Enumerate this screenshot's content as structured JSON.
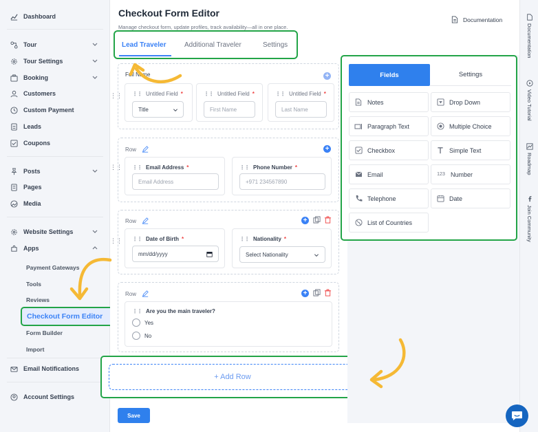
{
  "sidebar": {
    "items": [
      {
        "label": "Dashboard"
      },
      {
        "label": "Tour"
      },
      {
        "label": "Tour Settings"
      },
      {
        "label": "Booking"
      },
      {
        "label": "Customers"
      },
      {
        "label": "Custom Payment"
      },
      {
        "label": "Leads"
      },
      {
        "label": "Coupons"
      },
      {
        "label": "Posts"
      },
      {
        "label": "Pages"
      },
      {
        "label": "Media"
      },
      {
        "label": "Website Settings"
      },
      {
        "label": "Apps"
      }
    ],
    "apps_sub": [
      "Payment Gateways",
      "Tools",
      "Reviews",
      "Checkout Form Editor",
      "Form Builder",
      "Import"
    ],
    "bottom": [
      {
        "label": "Email Notifications"
      },
      {
        "label": "Account Settings"
      }
    ]
  },
  "header": {
    "title": "Checkout Form Editor",
    "subtitle": "Manage checkout form, update profiles, track availability—all in one place.",
    "docs_label": "Documentation"
  },
  "tabs": [
    "Lead Traveler",
    "Additional Traveler",
    "Settings"
  ],
  "rows": {
    "first": {
      "label": "Full Name",
      "fields": [
        {
          "label": "Untitled Field",
          "value": "Title"
        },
        {
          "label": "Untitled Field",
          "placeholder": "First Name"
        },
        {
          "label": "Untitled Field",
          "placeholder": "Last Name"
        }
      ]
    },
    "second": {
      "label": "Row",
      "fields": [
        {
          "label": "Email Address",
          "placeholder": "Email Address"
        },
        {
          "label": "Phone Number",
          "placeholder": "+971 234567890"
        }
      ]
    },
    "third": {
      "label": "Row",
      "fields": [
        {
          "label": "Date of Birth",
          "value": "mm/dd/yyyy"
        },
        {
          "label": "Nationality",
          "value": "Select Nationality"
        }
      ]
    },
    "fourth": {
      "label": "Row",
      "question": "Are you the main traveler?",
      "options": [
        "Yes",
        "No"
      ]
    }
  },
  "add_row": "+ Add Row",
  "save": "Save",
  "panel": {
    "tabs": [
      "Fields",
      "Settings"
    ],
    "items": [
      {
        "label": "Notes",
        "icon": "notes-icon"
      },
      {
        "label": "Drop Down",
        "icon": "dropdown-icon"
      },
      {
        "label": "Paragraph Text",
        "icon": "paragraph-icon"
      },
      {
        "label": "Multiple Choice",
        "icon": "radio-icon"
      },
      {
        "label": "Checkbox",
        "icon": "checkbox-icon"
      },
      {
        "label": "Simple Text",
        "icon": "text-icon"
      },
      {
        "label": "Email",
        "icon": "email-icon"
      },
      {
        "label": "Number",
        "icon": "number-icon",
        "glyph": "123"
      },
      {
        "label": "Telephone",
        "icon": "phone-icon"
      },
      {
        "label": "Date",
        "icon": "calendar-icon"
      },
      {
        "label": "List of Countries",
        "icon": "globe-icon"
      }
    ]
  },
  "rightbar": [
    "Documentation",
    "Video Tutorial",
    "Roadmap",
    "Join Community"
  ],
  "colors": {
    "accent": "#2f80ed",
    "highlight": "#22a447",
    "arrow": "#f5b935"
  }
}
